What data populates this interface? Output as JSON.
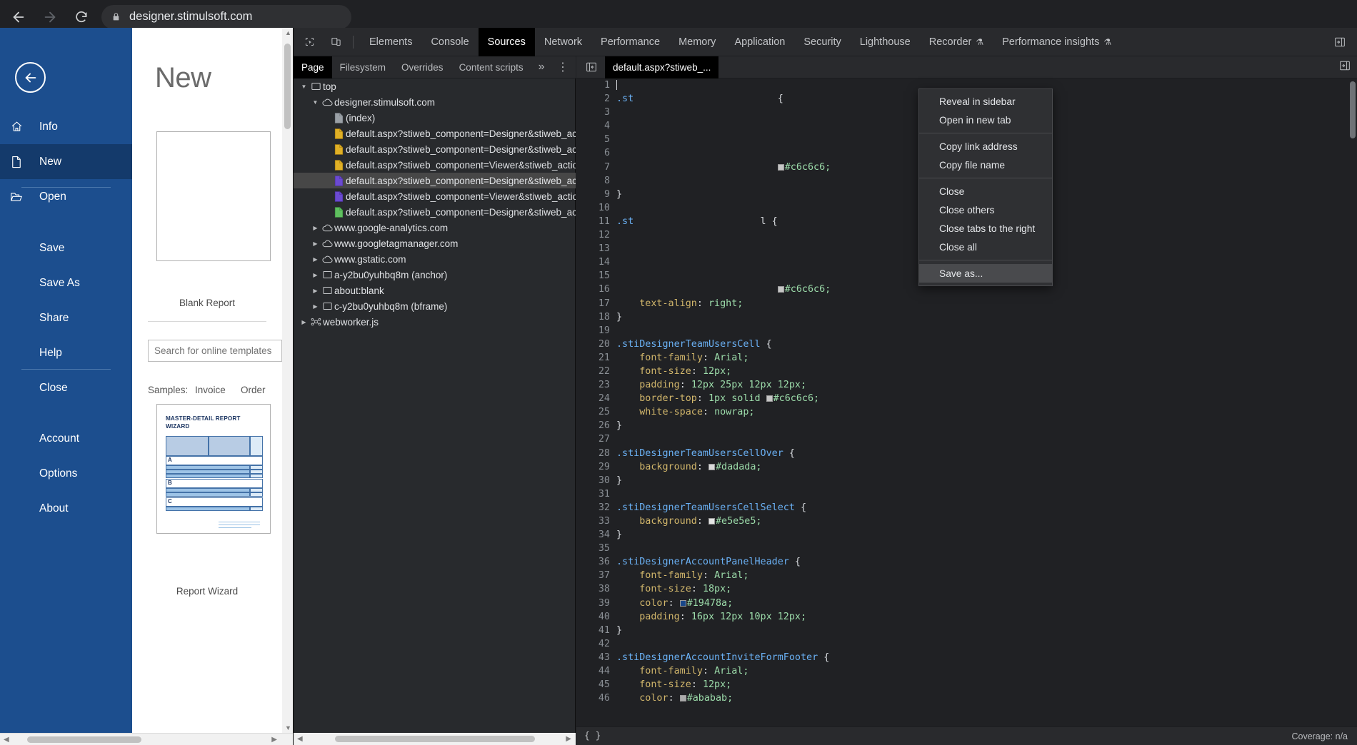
{
  "browser": {
    "back_icon": "arrow-left-icon",
    "forward_icon": "arrow-right-icon",
    "reload_icon": "reload-icon",
    "lock_icon": "lock-icon",
    "url": "designer.stimulsoft.com"
  },
  "report_app": {
    "back_icon": "circle-arrow-left-icon",
    "title": "New",
    "menu": [
      {
        "label": "Info",
        "icon": "home-icon",
        "active": false,
        "indent": false
      },
      {
        "label": "New",
        "icon": "page-icon",
        "active": true,
        "indent": false
      },
      {
        "label": "Open",
        "icon": "folder-open-icon",
        "active": false,
        "indent": false
      },
      {
        "label": "Save",
        "icon": "",
        "active": false,
        "indent": true
      },
      {
        "label": "Save As",
        "icon": "",
        "active": false,
        "indent": true
      },
      {
        "label": "Share",
        "icon": "",
        "active": false,
        "indent": true
      },
      {
        "label": "Help",
        "icon": "",
        "active": false,
        "indent": true
      },
      {
        "label": "Close",
        "icon": "",
        "active": false,
        "indent": true
      },
      {
        "label": "Account",
        "icon": "",
        "active": false,
        "indent": true
      },
      {
        "label": "Options",
        "icon": "",
        "active": false,
        "indent": true
      },
      {
        "label": "About",
        "icon": "",
        "active": false,
        "indent": true
      }
    ],
    "blank_report_caption": "Blank Report",
    "search_placeholder": "Search for online templates",
    "search_value": "",
    "samples_label": "Samples:",
    "sample_links": [
      "Invoice",
      "Order"
    ],
    "wizard_caption": "Report Wizard",
    "wizard_thumb_title": "MASTER-DETAIL REPORT WIZARD",
    "wizard_group_letters": [
      "A",
      "B",
      "C"
    ]
  },
  "devtools": {
    "inspect_icon": "cursor-select-icon",
    "device_icon": "device-toolbar-icon",
    "tabs": [
      {
        "label": "Elements",
        "active": false,
        "flask": false
      },
      {
        "label": "Console",
        "active": false,
        "flask": false
      },
      {
        "label": "Sources",
        "active": true,
        "flask": false
      },
      {
        "label": "Network",
        "active": false,
        "flask": false
      },
      {
        "label": "Performance",
        "active": false,
        "flask": false
      },
      {
        "label": "Memory",
        "active": false,
        "flask": false
      },
      {
        "label": "Application",
        "active": false,
        "flask": false
      },
      {
        "label": "Security",
        "active": false,
        "flask": false
      },
      {
        "label": "Lighthouse",
        "active": false,
        "flask": false
      },
      {
        "label": "Recorder",
        "active": false,
        "flask": true
      },
      {
        "label": "Performance insights",
        "active": false,
        "flask": true
      }
    ],
    "expand_right_icon": "expand-panel-icon"
  },
  "navigator": {
    "tabs": [
      {
        "label": "Page",
        "active": true
      },
      {
        "label": "Filesystem",
        "active": false
      },
      {
        "label": "Overrides",
        "active": false
      },
      {
        "label": "Content scripts",
        "active": false
      }
    ],
    "more_icon": "chevron-double-right-icon",
    "menu_icon": "vertical-dots-icon",
    "tree": [
      {
        "label": "top",
        "icon": "frame-icon",
        "depth": 0,
        "twisty": "open",
        "selected": false
      },
      {
        "label": "designer.stimulsoft.com",
        "icon": "cloud-icon",
        "depth": 1,
        "twisty": "open",
        "selected": false
      },
      {
        "label": "(index)",
        "icon": "file-gray-icon",
        "depth": 2,
        "twisty": "none",
        "selected": false
      },
      {
        "label": "default.aspx?stiweb_component=Designer&stiweb_actio",
        "icon": "file-yellow-icon",
        "depth": 2,
        "twisty": "none",
        "selected": false
      },
      {
        "label": "default.aspx?stiweb_component=Designer&stiweb_actio",
        "icon": "file-yellow-icon",
        "depth": 2,
        "twisty": "none",
        "selected": false
      },
      {
        "label": "default.aspx?stiweb_component=Viewer&stiweb_action=",
        "icon": "file-yellow-icon",
        "depth": 2,
        "twisty": "none",
        "selected": false
      },
      {
        "label": "default.aspx?stiweb_component=Designer&stiweb_actio",
        "icon": "file-purple-icon",
        "depth": 2,
        "twisty": "none",
        "selected": true
      },
      {
        "label": "default.aspx?stiweb_component=Viewer&stiweb_action=",
        "icon": "file-purple-icon",
        "depth": 2,
        "twisty": "none",
        "selected": false
      },
      {
        "label": "default.aspx?stiweb_component=Designer&stiweb_actio",
        "icon": "file-green-icon",
        "depth": 2,
        "twisty": "none",
        "selected": false
      },
      {
        "label": "www.google-analytics.com",
        "icon": "cloud-icon",
        "depth": 1,
        "twisty": "closed",
        "selected": false
      },
      {
        "label": "www.googletagmanager.com",
        "icon": "cloud-icon",
        "depth": 1,
        "twisty": "closed",
        "selected": false
      },
      {
        "label": "www.gstatic.com",
        "icon": "cloud-icon",
        "depth": 1,
        "twisty": "closed",
        "selected": false
      },
      {
        "label": "a-y2bu0yuhbq8m (anchor)",
        "icon": "frame-icon",
        "depth": 1,
        "twisty": "closed",
        "selected": false
      },
      {
        "label": "about:blank",
        "icon": "frame-icon",
        "depth": 1,
        "twisty": "closed",
        "selected": false
      },
      {
        "label": "c-y2bu0yuhbq8m (bframe)",
        "icon": "frame-icon",
        "depth": 1,
        "twisty": "closed",
        "selected": false
      },
      {
        "label": "webworker.js",
        "icon": "worker-icon",
        "depth": 0,
        "twisty": "closed",
        "selected": false
      }
    ]
  },
  "editor": {
    "panel_toggle_icon": "show-navigator-icon",
    "tab_label": "default.aspx?stiweb_...",
    "right_panel_icon": "show-debugger-icon",
    "status_format_icon": "{ }",
    "status_coverage": "Coverage: n/a",
    "lines": [
      {
        "n": 1,
        "segs": [
          {
            "t": "caret",
            "v": ""
          }
        ]
      },
      {
        "n": 2,
        "segs": [
          {
            "t": "sel",
            "v": ".st"
          },
          {
            "t": "plain",
            "v": "                         {"
          }
        ]
      },
      {
        "n": 3,
        "segs": []
      },
      {
        "n": 4,
        "segs": []
      },
      {
        "n": 5,
        "segs": []
      },
      {
        "n": 6,
        "segs": []
      },
      {
        "n": 7,
        "segs": [
          {
            "t": "plain",
            "v": "                            "
          },
          {
            "t": "swatch",
            "v": "#c6c6c6"
          },
          {
            "t": "val",
            "v": "#c6c6c6;"
          }
        ]
      },
      {
        "n": 8,
        "segs": []
      },
      {
        "n": 9,
        "segs": [
          {
            "t": "plain",
            "v": "}"
          }
        ]
      },
      {
        "n": 10,
        "segs": []
      },
      {
        "n": 11,
        "segs": [
          {
            "t": "sel",
            "v": ".st"
          },
          {
            "t": "plain",
            "v": "                      l {"
          }
        ]
      },
      {
        "n": 12,
        "segs": []
      },
      {
        "n": 13,
        "segs": []
      },
      {
        "n": 14,
        "segs": []
      },
      {
        "n": 15,
        "segs": []
      },
      {
        "n": 16,
        "segs": [
          {
            "t": "plain",
            "v": "                            "
          },
          {
            "t": "swatch",
            "v": "#c6c6c6"
          },
          {
            "t": "val",
            "v": "#c6c6c6;"
          }
        ]
      },
      {
        "n": 17,
        "segs": [
          {
            "t": "prop",
            "v": "    text-align"
          },
          {
            "t": "punc",
            "v": ": "
          },
          {
            "t": "val",
            "v": "right;"
          }
        ]
      },
      {
        "n": 18,
        "segs": [
          {
            "t": "plain",
            "v": "}"
          }
        ]
      },
      {
        "n": 19,
        "segs": []
      },
      {
        "n": 20,
        "segs": [
          {
            "t": "sel",
            "v": ".stiDesignerTeamUsersCell"
          },
          {
            "t": "punc",
            "v": " {"
          }
        ]
      },
      {
        "n": 21,
        "segs": [
          {
            "t": "prop",
            "v": "    font-family"
          },
          {
            "t": "punc",
            "v": ": "
          },
          {
            "t": "val",
            "v": "Arial;"
          }
        ]
      },
      {
        "n": 22,
        "segs": [
          {
            "t": "prop",
            "v": "    font-size"
          },
          {
            "t": "punc",
            "v": ": "
          },
          {
            "t": "val",
            "v": "12px;"
          }
        ]
      },
      {
        "n": 23,
        "segs": [
          {
            "t": "prop",
            "v": "    padding"
          },
          {
            "t": "punc",
            "v": ": "
          },
          {
            "t": "val",
            "v": "12px 25px 12px 12px;"
          }
        ]
      },
      {
        "n": 24,
        "segs": [
          {
            "t": "prop",
            "v": "    border-top"
          },
          {
            "t": "punc",
            "v": ": "
          },
          {
            "t": "val",
            "v": "1px solid "
          },
          {
            "t": "swatch",
            "v": "#c6c6c6"
          },
          {
            "t": "val",
            "v": "#c6c6c6;"
          }
        ]
      },
      {
        "n": 25,
        "segs": [
          {
            "t": "prop",
            "v": "    white-space"
          },
          {
            "t": "punc",
            "v": ": "
          },
          {
            "t": "val",
            "v": "nowrap;"
          }
        ]
      },
      {
        "n": 26,
        "segs": [
          {
            "t": "plain",
            "v": "}"
          }
        ]
      },
      {
        "n": 27,
        "segs": []
      },
      {
        "n": 28,
        "segs": [
          {
            "t": "sel",
            "v": ".stiDesignerTeamUsersCellOver"
          },
          {
            "t": "punc",
            "v": " {"
          }
        ]
      },
      {
        "n": 29,
        "segs": [
          {
            "t": "prop",
            "v": "    background"
          },
          {
            "t": "punc",
            "v": ": "
          },
          {
            "t": "swatch",
            "v": "#dadada"
          },
          {
            "t": "val",
            "v": "#dadada;"
          }
        ]
      },
      {
        "n": 30,
        "segs": [
          {
            "t": "plain",
            "v": "}"
          }
        ]
      },
      {
        "n": 31,
        "segs": []
      },
      {
        "n": 32,
        "segs": [
          {
            "t": "sel",
            "v": ".stiDesignerTeamUsersCellSelect"
          },
          {
            "t": "punc",
            "v": " {"
          }
        ]
      },
      {
        "n": 33,
        "segs": [
          {
            "t": "prop",
            "v": "    background"
          },
          {
            "t": "punc",
            "v": ": "
          },
          {
            "t": "swatch",
            "v": "#e5e5e5"
          },
          {
            "t": "val",
            "v": "#e5e5e5;"
          }
        ]
      },
      {
        "n": 34,
        "segs": [
          {
            "t": "plain",
            "v": "}"
          }
        ]
      },
      {
        "n": 35,
        "segs": []
      },
      {
        "n": 36,
        "segs": [
          {
            "t": "sel",
            "v": ".stiDesignerAccountPanelHeader"
          },
          {
            "t": "punc",
            "v": " {"
          }
        ]
      },
      {
        "n": 37,
        "segs": [
          {
            "t": "prop",
            "v": "    font-family"
          },
          {
            "t": "punc",
            "v": ": "
          },
          {
            "t": "val",
            "v": "Arial;"
          }
        ]
      },
      {
        "n": 38,
        "segs": [
          {
            "t": "prop",
            "v": "    font-size"
          },
          {
            "t": "punc",
            "v": ": "
          },
          {
            "t": "val",
            "v": "18px;"
          }
        ]
      },
      {
        "n": 39,
        "segs": [
          {
            "t": "prop",
            "v": "    color"
          },
          {
            "t": "punc",
            "v": ": "
          },
          {
            "t": "swatch",
            "v": "#19478a"
          },
          {
            "t": "val",
            "v": "#19478a;"
          }
        ]
      },
      {
        "n": 40,
        "segs": [
          {
            "t": "prop",
            "v": "    padding"
          },
          {
            "t": "punc",
            "v": ": "
          },
          {
            "t": "val",
            "v": "16px 12px 10px 12px;"
          }
        ]
      },
      {
        "n": 41,
        "segs": [
          {
            "t": "plain",
            "v": "}"
          }
        ]
      },
      {
        "n": 42,
        "segs": []
      },
      {
        "n": 43,
        "segs": [
          {
            "t": "sel",
            "v": ".stiDesignerAccountInviteFormFooter"
          },
          {
            "t": "punc",
            "v": " {"
          }
        ]
      },
      {
        "n": 44,
        "segs": [
          {
            "t": "prop",
            "v": "    font-family"
          },
          {
            "t": "punc",
            "v": ": "
          },
          {
            "t": "val",
            "v": "Arial;"
          }
        ]
      },
      {
        "n": 45,
        "segs": [
          {
            "t": "prop",
            "v": "    font-size"
          },
          {
            "t": "punc",
            "v": ": "
          },
          {
            "t": "val",
            "v": "12px;"
          }
        ]
      },
      {
        "n": 46,
        "segs": [
          {
            "t": "prop",
            "v": "    color"
          },
          {
            "t": "punc",
            "v": ": "
          },
          {
            "t": "swatch",
            "v": "#ababab"
          },
          {
            "t": "val",
            "v": "#ababab;"
          }
        ]
      }
    ]
  },
  "context_menu": {
    "groups": [
      {
        "items": [
          {
            "label": "Reveal in sidebar",
            "highlight": false
          },
          {
            "label": "Open in new tab",
            "highlight": false
          }
        ]
      },
      {
        "items": [
          {
            "label": "Copy link address",
            "highlight": false
          },
          {
            "label": "Copy file name",
            "highlight": false
          }
        ]
      },
      {
        "items": [
          {
            "label": "Close",
            "highlight": false
          },
          {
            "label": "Close others",
            "highlight": false
          },
          {
            "label": "Close tabs to the right",
            "highlight": false
          },
          {
            "label": "Close all",
            "highlight": false
          }
        ]
      },
      {
        "items": [
          {
            "label": "Save as...",
            "highlight": true
          }
        ]
      }
    ]
  },
  "colors": {
    "ribbon_blue": "#1c4e8e",
    "ribbon_active": "#143a6b",
    "devtools_bg": "#202124",
    "devtools_panel": "#292a2d",
    "accent_selector": "#6ab0f3",
    "accent_value": "#9cdcaa",
    "accent_property": "#d1b66b"
  }
}
